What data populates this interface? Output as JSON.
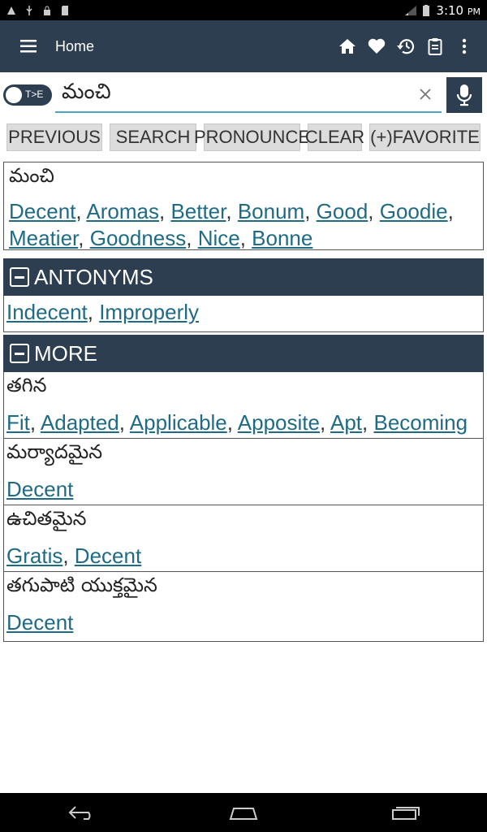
{
  "status_bar": {
    "time": "3:10",
    "ampm": "PM"
  },
  "app_bar": {
    "title": "Home"
  },
  "search": {
    "toggle_label": "T>E",
    "value": "మంచి"
  },
  "buttons": {
    "previous": "PREVIOUS",
    "search": "SEARCH",
    "pronounce": "PRONOUNCE",
    "clear": "CLEAR",
    "favorite": "(+)FAVORITE"
  },
  "result": {
    "word": "మంచి",
    "meanings": [
      "Decent",
      "Aromas",
      "Better",
      "Bonum",
      "Good",
      "Goodie",
      "Meatier",
      "Goodness",
      "Nice",
      "Bonne"
    ]
  },
  "antonyms": {
    "header": "ANTONYMS",
    "items": [
      "Indecent",
      "Improperly"
    ]
  },
  "more": {
    "header": "MORE",
    "entries": [
      {
        "word": "తగిన",
        "meanings": [
          "Fit",
          "Adapted",
          "Applicable",
          "Apposite",
          "Apt",
          "Becoming"
        ]
      },
      {
        "word": "మర్యాదమైన",
        "meanings": [
          "Decent"
        ]
      },
      {
        "word": "ఉచితమైన",
        "meanings": [
          "Gratis",
          "Decent"
        ]
      },
      {
        "word": "తగుపాటి యుక్తమైన",
        "meanings": [
          "Decent"
        ]
      }
    ]
  },
  "icons": {
    "menu": "menu-icon",
    "home": "home-icon",
    "favorite": "heart-icon",
    "history": "history-icon",
    "clipboard": "clipboard-icon",
    "more": "more-vert-icon",
    "mic": "mic-icon",
    "clear": "close-icon"
  },
  "colors": {
    "primary": "#2c3e50",
    "link": "#1f6b86",
    "accent": "#4aa3c9",
    "button_bg": "#dcdcdc"
  }
}
